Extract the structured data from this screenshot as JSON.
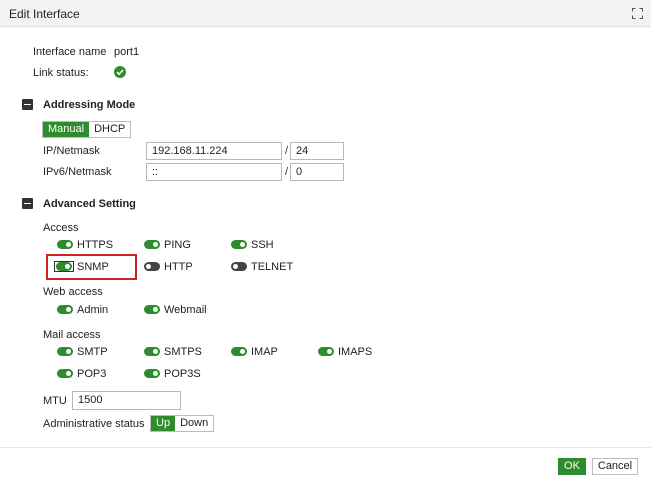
{
  "window": {
    "title": "Edit Interface",
    "maximize_icon": "maximize-icon"
  },
  "interface": {
    "name_label": "Interface name",
    "name_value": "port1",
    "link_status_label": "Link status:",
    "link_status_icon": "check-circle-icon"
  },
  "addressing": {
    "section_title": "Addressing Mode",
    "modes": [
      "Manual",
      "DHCP"
    ],
    "selected_mode": "Manual",
    "ip_label": "IP/Netmask",
    "ip_value": "192.168.11.224",
    "ip_mask": "24",
    "ipv6_label": "IPv6/Netmask",
    "ipv6_value": "::",
    "ipv6_mask": "0",
    "separator": "/"
  },
  "advanced": {
    "section_title": "Advanced Setting",
    "access_label": "Access",
    "access": [
      {
        "label": "HTTPS",
        "on": true
      },
      {
        "label": "PING",
        "on": true
      },
      {
        "label": "SSH",
        "on": true
      },
      {
        "label": "SNMP",
        "on": true
      },
      {
        "label": "HTTP",
        "on": false
      },
      {
        "label": "TELNET",
        "on": false
      }
    ],
    "web_access_label": "Web access",
    "web_access": [
      {
        "label": "Admin",
        "on": true
      },
      {
        "label": "Webmail",
        "on": true
      }
    ],
    "mail_access_label": "Mail access",
    "mail_access": [
      {
        "label": "SMTP",
        "on": true
      },
      {
        "label": "SMTPS",
        "on": true
      },
      {
        "label": "IMAP",
        "on": true
      },
      {
        "label": "IMAPS",
        "on": true
      },
      {
        "label": "POP3",
        "on": true
      },
      {
        "label": "POP3S",
        "on": true
      }
    ],
    "mtu_label": "MTU",
    "mtu_value": "1500",
    "admin_status_label": "Administrative status",
    "admin_status_options": [
      "Up",
      "Down"
    ],
    "admin_status_selected": "Up"
  },
  "footer": {
    "ok_label": "OK",
    "cancel_label": "Cancel"
  },
  "colors": {
    "accent": "#2e8b2e",
    "highlight": "#d21f1f",
    "toggle_off": "#444444"
  }
}
